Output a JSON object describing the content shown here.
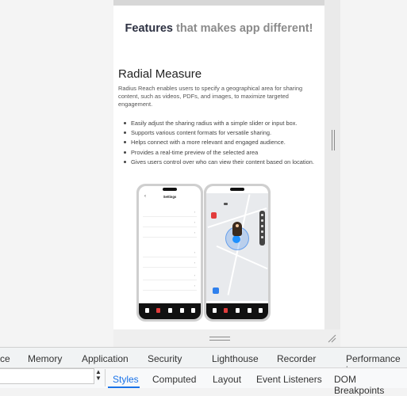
{
  "page": {
    "heading_prefix": "Features",
    "heading_suffix": "that makes app different!",
    "section_title": "Radial Measure",
    "description": "Radius Reach enables users to specify a geographical area for sharing content, such as videos, PDFs, and images, to maximize targeted engagement.",
    "features": [
      "Easily adjust the sharing radius with a simple slider or input box.",
      "Supports various content formats for versatile sharing.",
      "Helps connect with a more relevant and engaged audience.",
      "Provides a real-time preview of the selected area",
      "Gives users control over who can view their content based on location."
    ]
  },
  "phone1": {
    "screen_title": "Settings"
  },
  "devtools": {
    "tabs": [
      "ce",
      "Memory",
      "Application",
      "Security",
      "Lighthouse",
      "Recorder",
      "Performance in"
    ],
    "subtabs": [
      "Styles",
      "Computed",
      "Layout",
      "Event Listeners",
      "DOM Breakpoints"
    ],
    "active_subtab": "Styles",
    "accent": "#1a73e8"
  },
  "colors": {
    "heading": "#2d3142",
    "heading_muted": "#8b8b8b",
    "brand_red": "#e23c3c",
    "radius_blue": "#1e90ff"
  }
}
